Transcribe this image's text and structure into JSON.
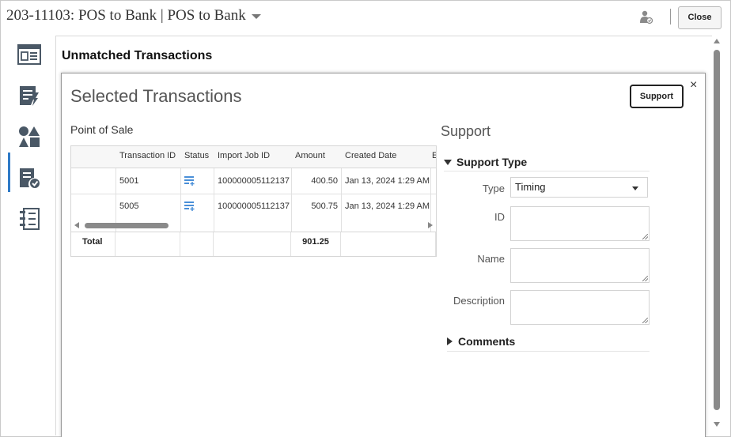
{
  "header": {
    "title": "203-11103: POS to Bank | POS to Bank",
    "close_label": "Close"
  },
  "nav": {
    "items": [
      {
        "name": "summary-icon"
      },
      {
        "name": "activity-icon"
      },
      {
        "name": "matching-icon"
      },
      {
        "name": "review-icon"
      },
      {
        "name": "list-icon"
      }
    ]
  },
  "main": {
    "heading": "Unmatched Transactions"
  },
  "dialog": {
    "title": "Selected Transactions",
    "support_button": "Support",
    "close_glyph": "×",
    "pos": {
      "label": "Point of Sale",
      "columns": [
        "",
        "Transaction ID",
        "Status",
        "Import Job ID",
        "Amount",
        "Created Date",
        "E"
      ],
      "rows": [
        {
          "transaction_id": "5001",
          "import_job_id": "100000005112137",
          "amount": "400.50",
          "created_date": "Jan 13, 2024 1:29 AM"
        },
        {
          "transaction_id": "5005",
          "import_job_id": "100000005112137",
          "amount": "500.75",
          "created_date": "Jan 13, 2024 1:29 AM"
        }
      ],
      "total_label": "Total",
      "total_amount": "901.25"
    },
    "support": {
      "title": "Support",
      "section_label": "Support Type",
      "type_label": "Type",
      "type_value": "Timing",
      "id_label": "ID",
      "name_label": "Name",
      "description_label": "Description",
      "comments_label": "Comments"
    }
  },
  "colors": {
    "accent": "#2f7ac7",
    "status_icon": "#4a8fd8"
  }
}
